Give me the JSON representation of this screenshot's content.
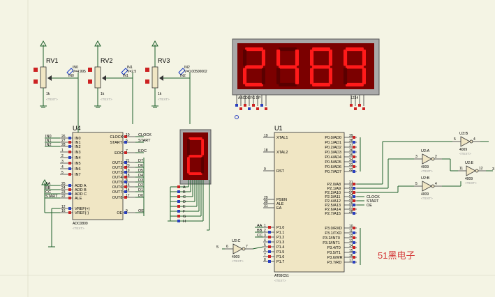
{
  "colors": {
    "background": "#f4f4e4",
    "wire": "#1d5e2a",
    "chip_fill": "#f0e6c4",
    "segment_on": "#ff1a1a",
    "segment_off": "#5a0000",
    "display_bg": "#a00000",
    "pin_red": "#cc2222",
    "pin_blue": "#2a3fbf",
    "watermark": "#d43a3a",
    "probe": "#1a3cc8"
  },
  "pots": [
    {
      "ref": "RV1",
      "value": "1k",
      "text": "<TEXT>",
      "probe_net": "IN0",
      "probe_value": "V=4.995",
      "wire_label": "IN0"
    },
    {
      "ref": "RV2",
      "value": "1k",
      "text": "<TEXT>",
      "probe_net": "IN1",
      "probe_value": "V=2.5",
      "wire_label": "IN1"
    },
    {
      "ref": "RV3",
      "value": "1k",
      "text": "<TEXT>",
      "probe_net": "IN2",
      "probe_value": "V=0.00500002",
      "wire_label": "IN2"
    }
  ],
  "display4": {
    "digits": "2489",
    "seg_label": "ABCDEFG DP",
    "com_label": "1234"
  },
  "display1": {
    "digit": "2"
  },
  "adc": {
    "ref": "U4",
    "part": "ADC0809",
    "text": "<TEXT>",
    "left_pins": [
      {
        "num": "26",
        "name": "IN0",
        "net": "IN0"
      },
      {
        "num": "27",
        "name": "IN1",
        "net": "IN1"
      },
      {
        "num": "28",
        "name": "IN2",
        "net": "IN2"
      },
      {
        "num": "1",
        "name": "IN3",
        "net": ""
      },
      {
        "num": "2",
        "name": "IN4",
        "net": ""
      },
      {
        "num": "3",
        "name": "IN5",
        "net": ""
      },
      {
        "num": "4",
        "name": "IN6",
        "net": ""
      },
      {
        "num": "5",
        "name": "IN7",
        "net": ""
      },
      {
        "num": "25",
        "name": "ADD A",
        "net": "AA"
      },
      {
        "num": "24",
        "name": "ADD B",
        "net": "BB"
      },
      {
        "num": "23",
        "name": "ADD C",
        "net": "CC"
      },
      {
        "num": "22",
        "name": "ALE",
        "net": "START"
      },
      {
        "num": "12",
        "name": "VREF(+)",
        "net": ""
      },
      {
        "num": "16",
        "name": "VREF(-)",
        "net": ""
      }
    ],
    "right_pins": [
      {
        "num": "10",
        "name": "CLOCK",
        "net": "CLOCK"
      },
      {
        "num": "6",
        "name": "START",
        "net": "START"
      },
      {
        "num": "7",
        "name": "EOC",
        "net": "EOC"
      },
      {
        "num": "21",
        "name": "OUT1",
        "net": "D7"
      },
      {
        "num": "20",
        "name": "OUT2",
        "net": "D6"
      },
      {
        "num": "19",
        "name": "OUT3",
        "net": "D5"
      },
      {
        "num": "18",
        "name": "OUT4",
        "net": "D4"
      },
      {
        "num": "8",
        "name": "OUT5",
        "net": "D3"
      },
      {
        "num": "15",
        "name": "OUT6",
        "net": "D2"
      },
      {
        "num": "14",
        "name": "OUT7",
        "net": "D1"
      },
      {
        "num": "17",
        "name": "OUT8",
        "net": "D0"
      },
      {
        "num": "9",
        "name": "OE",
        "net": "OE"
      }
    ]
  },
  "mcu": {
    "ref": "U1",
    "part": "AT89C51",
    "text": "<TEXT>",
    "left_pins": [
      {
        "num": "19",
        "name": "XTAL1"
      },
      {
        "num": "18",
        "name": "XTAL2"
      },
      {
        "num": "9",
        "name": "RST"
      },
      {
        "num": "29",
        "name": "PSEN"
      },
      {
        "num": "30",
        "name": "ALE"
      },
      {
        "num": "31",
        "name": "EA"
      },
      {
        "num": "1",
        "name": "P1.0",
        "net": "AA"
      },
      {
        "num": "2",
        "name": "P1.1",
        "net": "BB"
      },
      {
        "num": "3",
        "name": "P1.2",
        "net": "CC"
      },
      {
        "num": "4",
        "name": "P1.3"
      },
      {
        "num": "5",
        "name": "P1.4"
      },
      {
        "num": "6",
        "name": "P1.5"
      },
      {
        "num": "7",
        "name": "P1.6"
      },
      {
        "num": "8",
        "name": "P1.7"
      }
    ],
    "right_pins": [
      {
        "num": "39",
        "name": "P0.0/AD0"
      },
      {
        "num": "38",
        "name": "P0.1/AD1"
      },
      {
        "num": "37",
        "name": "P0.2/AD2"
      },
      {
        "num": "36",
        "name": "P0.3/AD3"
      },
      {
        "num": "35",
        "name": "P0.4/AD4"
      },
      {
        "num": "34",
        "name": "P0.5/AD5"
      },
      {
        "num": "33",
        "name": "P0.6/AD6"
      },
      {
        "num": "32",
        "name": "P0.7/AD7"
      },
      {
        "num": "21",
        "name": "P2.0/A8"
      },
      {
        "num": "22",
        "name": "P2.1/A9"
      },
      {
        "num": "23",
        "name": "P2.2/A10"
      },
      {
        "num": "24",
        "name": "P2.3/A11",
        "net": "CLOCK"
      },
      {
        "num": "25",
        "name": "P2.4/A12",
        "net": "START"
      },
      {
        "num": "26",
        "name": "P2.5/A13",
        "net": "OE"
      },
      {
        "num": "27",
        "name": "P2.6/A14"
      },
      {
        "num": "28",
        "name": "P2.7/A15"
      },
      {
        "num": "10",
        "name": "P3.0/RXD"
      },
      {
        "num": "11",
        "name": "P3.1/TXD"
      },
      {
        "num": "12",
        "name": "P3.2/INT0"
      },
      {
        "num": "13",
        "name": "P3.3/INT1"
      },
      {
        "num": "14",
        "name": "P3.4/T0"
      },
      {
        "num": "15",
        "name": "P3.5/T1"
      },
      {
        "num": "16",
        "name": "P3.6/WR"
      },
      {
        "num": "17",
        "name": "P3.7/RD"
      }
    ]
  },
  "gates": [
    {
      "ref": "U3:B",
      "part": "4009",
      "text": "<TEXT>",
      "in": "5",
      "out": "4"
    },
    {
      "ref": "U2:A",
      "part": "4009",
      "text": "<TEXT>",
      "in": "3",
      "out": "2"
    },
    {
      "ref": "U2:E",
      "part": "4009",
      "text": "<TEXT>",
      "in": "11",
      "out": "12"
    },
    {
      "ref": "U2:B",
      "part": "4009",
      "text": "<TEXT>",
      "in": "5",
      "out": "4"
    },
    {
      "ref": "U2:C",
      "part": "4009",
      "text": "<TEXT>",
      "in": "6",
      "out": "7"
    }
  ],
  "net_labels": {
    "d_lines": [
      "D0",
      "D1",
      "D2",
      "D3",
      "D4",
      "D5",
      "D6",
      "D7"
    ],
    "seg_lines": [
      "A",
      "B",
      "C",
      "D",
      "E",
      "F",
      "G",
      "H"
    ],
    "gate_c_in": "5",
    "gate_e_out": "3"
  },
  "watermark": "51黑电子"
}
